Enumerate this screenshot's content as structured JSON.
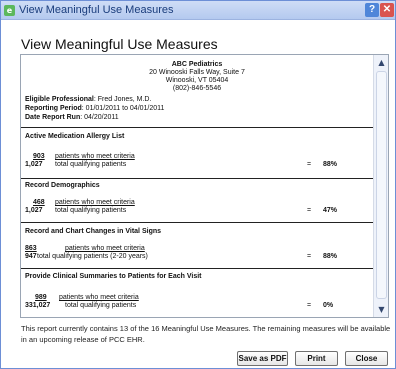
{
  "window": {
    "title": "View Meaningful Use Measures",
    "help_label": "?",
    "close_label": "✕",
    "icon_glyph": "e"
  },
  "dialog": {
    "heading": "View Meaningful Use Measures"
  },
  "report": {
    "org_name": "ABC Pediatrics",
    "address_line1": "20 Winooski Falls Way, Suite 7",
    "address_line2": "Winooski, VT 05404",
    "phone": "(802)-846-5546",
    "meta": [
      {
        "label": "Eligible Professional",
        "value": ": Fred Jones, M.D."
      },
      {
        "label": "Reporting Period",
        "value": ": 01/01/2011 to 04/01/2011"
      },
      {
        "label": "Date Report Run",
        "value": ": 04/20/2011"
      }
    ],
    "measures": [
      {
        "title": "Active Medication Allergy List",
        "numerator": "903",
        "numerator_text": "patients who meet criteria",
        "denominator": "1,027",
        "denominator_text": "total qualifying patients",
        "equals": "=",
        "percent": "88%"
      },
      {
        "title": "Record Demographics",
        "numerator": "468",
        "numerator_text": "patients who meet criteria",
        "denominator": "1,027",
        "denominator_text": "total qualifying patients",
        "equals": "=",
        "percent": "47%"
      },
      {
        "title": "Record and Chart Changes in Vital Signs",
        "numerator": "863",
        "numerator_text": "patients who meet criteria",
        "denominator": "947",
        "denominator_text": "total qualifying patients (2-20 years)",
        "equals": "=",
        "percent": "88%"
      },
      {
        "title": "Provide Clinical Summaries to Patients for Each Visit",
        "numerator": "989",
        "numerator_text": "patients who meet criteria",
        "denominator": "331,027",
        "denominator_text": "total qualifying patients",
        "equals": "=",
        "percent": "0%"
      }
    ]
  },
  "scrollbar": {
    "up_arrow": "▲",
    "down_arrow": "▼"
  },
  "footer": {
    "note": "This report currently contains 13 of the 16 Meaningful Use Measures.  The remaining measures will be available in an upcoming release of PCC EHR."
  },
  "buttons": {
    "save_pdf": "Save as PDF",
    "print": "Print",
    "close": "Close"
  }
}
